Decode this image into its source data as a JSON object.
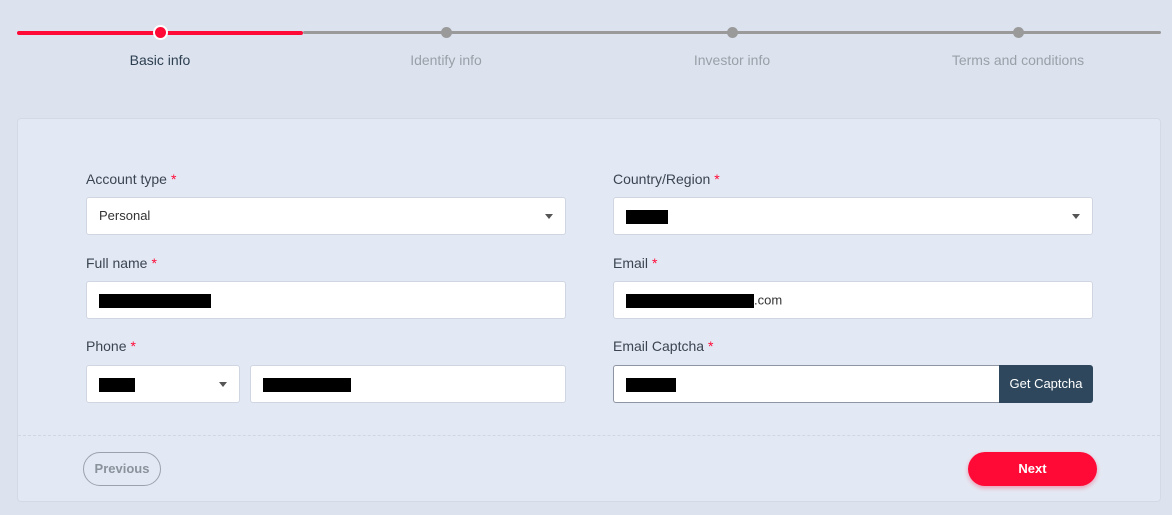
{
  "stepper": {
    "steps": [
      {
        "label": "Basic info",
        "state": "active"
      },
      {
        "label": "Identify info",
        "state": "pending"
      },
      {
        "label": "Investor info",
        "state": "pending"
      },
      {
        "label": "Terms and conditions",
        "state": "pending"
      }
    ],
    "progress_percent": 25
  },
  "form": {
    "account_type": {
      "label": "Account type",
      "required_mark": "*",
      "value": "Personal"
    },
    "country_region": {
      "label": "Country/Region",
      "required_mark": "*",
      "value": "[redacted]"
    },
    "full_name": {
      "label": "Full name",
      "required_mark": "*",
      "value": "[redacted]"
    },
    "email": {
      "label": "Email",
      "required_mark": "*",
      "value_suffix": ".com"
    },
    "phone": {
      "label": "Phone",
      "required_mark": "*",
      "code": "[redacted]",
      "number": "[redacted]"
    },
    "email_captcha": {
      "label": "Email Captcha",
      "required_mark": "*",
      "value": "[redacted]",
      "button_label": "Get Captcha"
    }
  },
  "footer": {
    "previous_label": "Previous",
    "next_label": "Next"
  },
  "colors": {
    "accent": "#ff0a37",
    "background": "#dce3ee",
    "card": "#e3e9f4",
    "captcha_button": "#2e475d"
  }
}
